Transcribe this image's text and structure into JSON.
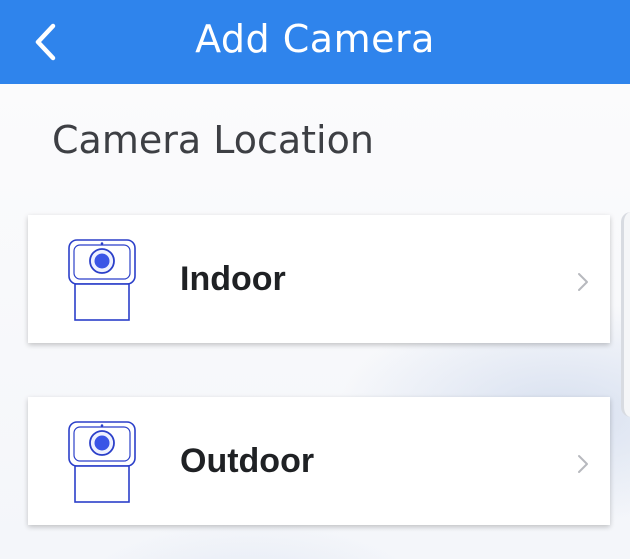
{
  "header": {
    "title": "Add Camera",
    "back_icon": "chevron-left-icon",
    "background_color": "#2f84ec"
  },
  "section": {
    "title": "Camera Location"
  },
  "locations": [
    {
      "label": "Indoor",
      "icon": "camera-icon",
      "chevron": "chevron-right-icon"
    },
    {
      "label": "Outdoor",
      "icon": "camera-icon",
      "chevron": "chevron-right-icon"
    }
  ],
  "colors": {
    "accent": "#2f84ec",
    "icon_outline": "#2b3fc9",
    "lens": "#3a55e6"
  }
}
